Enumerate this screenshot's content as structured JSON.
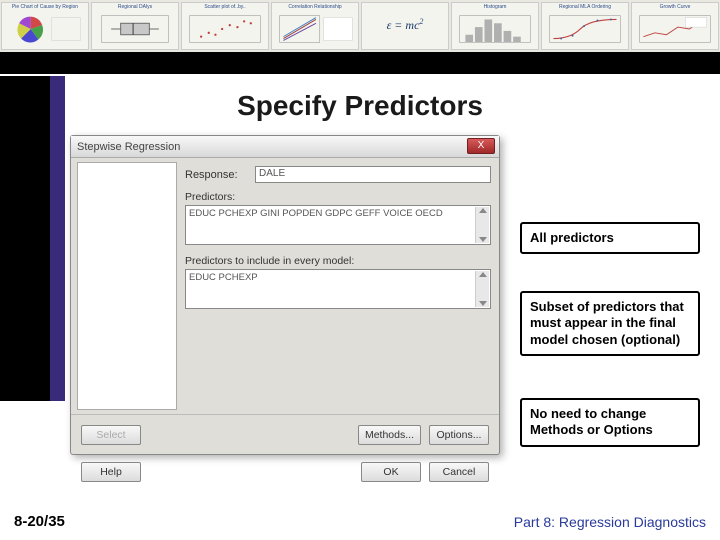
{
  "thumbs": [
    "Pie Chart of Cause by Region",
    "Regional DAlys",
    "Scatter plot of..by..",
    "Correlation Relationship",
    "E equals mc2",
    "Histogram",
    "Regional MLA Ordering",
    "Growth Curve"
  ],
  "slide": {
    "title": "Specify Predictors"
  },
  "dialog": {
    "title": "Stepwise Regression",
    "close": "X",
    "response_label": "Response:",
    "response_value": "DALE",
    "predictors_label": "Predictors:",
    "predictors_value": "EDUC PCHEXP GINI POPDEN GDPC GEFF VOICE OECD",
    "include_label": "Predictors to include in every model:",
    "include_value": "EDUC PCHEXP",
    "buttons": {
      "select": "Select",
      "methods": "Methods...",
      "options": "Options...",
      "help": "Help",
      "ok": "OK",
      "cancel": "Cancel"
    }
  },
  "annotations": {
    "a1": "All predictors",
    "a2": "Subset of predictors that must appear in the final model chosen (optional)",
    "a3": "No need to change Methods or Options"
  },
  "footer": {
    "page": "8-20/35",
    "part": "Part 8: Regression Diagnostics"
  }
}
